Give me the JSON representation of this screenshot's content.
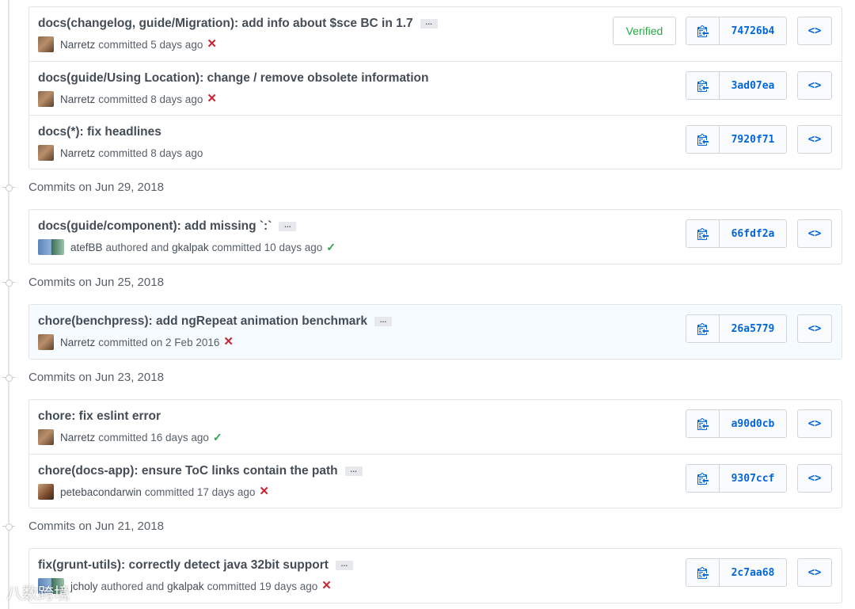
{
  "groups": [
    {
      "header": "",
      "commits": [
        {
          "title": "docs(changelog, guide/Migration): add info about $sce BC in 1.7",
          "ellipsis": true,
          "avatar": "narretz",
          "author": "Narretz",
          "meta": "committed 5 days ago",
          "status": "fail",
          "verified": "Verified",
          "sha": "74726b4",
          "highlight": false
        },
        {
          "title": "docs(guide/Using Location): change / remove obsolete information",
          "ellipsis": false,
          "avatar": "narretz",
          "author": "Narretz",
          "meta": "committed 8 days ago",
          "status": "fail",
          "verified": "",
          "sha": "3ad07ea",
          "highlight": false
        },
        {
          "title": "docs(*): fix headlines",
          "ellipsis": false,
          "avatar": "narretz",
          "author": "Narretz",
          "meta": "committed 8 days ago",
          "status": "none",
          "verified": "",
          "sha": "7920f71",
          "highlight": false
        }
      ]
    },
    {
      "header": "Commits on Jun 29, 2018",
      "commits": [
        {
          "title": "docs(guide/component): add missing `:`",
          "ellipsis": true,
          "avatar": "pair",
          "author": "atefBB",
          "meta_mid": "authored and",
          "coauthor": "gkalpak",
          "meta": "committed 10 days ago",
          "status": "pass",
          "verified": "",
          "sha": "66fdf2a",
          "highlight": false
        }
      ]
    },
    {
      "header": "Commits on Jun 25, 2018",
      "commits": [
        {
          "title": "chore(benchpress): add ngRepeat animation benchmark",
          "ellipsis": true,
          "avatar": "narretz",
          "author": "Narretz",
          "meta": "committed on 2 Feb 2016",
          "status": "fail",
          "verified": "",
          "sha": "26a5779",
          "highlight": true
        }
      ]
    },
    {
      "header": "Commits on Jun 23, 2018",
      "commits": [
        {
          "title": "chore: fix eslint error",
          "ellipsis": false,
          "avatar": "narretz",
          "author": "Narretz",
          "meta": "committed 16 days ago",
          "status": "pass",
          "verified": "",
          "sha": "a90d0cb",
          "highlight": false
        },
        {
          "title": "chore(docs-app): ensure ToC links contain the path",
          "ellipsis": true,
          "avatar": "petebacon",
          "author": "petebacondarwin",
          "meta": "committed 17 days ago",
          "status": "fail",
          "verified": "",
          "sha": "9307ccf",
          "highlight": false
        }
      ]
    },
    {
      "header": "Commits on Jun 21, 2018",
      "commits": [
        {
          "title": "fix(grunt-utils): correctly detect java 32bit support",
          "ellipsis": true,
          "avatar": "pair",
          "author": "jcholy",
          "meta_mid": "authored and",
          "coauthor": "gkalpak",
          "meta": "committed 19 days ago",
          "status": "fail",
          "verified": "",
          "sha": "2c7aa68",
          "highlight": false
        }
      ]
    }
  ],
  "labels": {
    "ellipsis": "…",
    "browse": "<>",
    "status_fail": "✕",
    "status_pass": "✓"
  },
  "icons": {
    "copy": "clipboard-icon",
    "browse": "code-icon",
    "fail": "x-icon",
    "pass": "check-icon"
  },
  "colors": {
    "link": "#0366d6",
    "fail": "#cb2431",
    "pass": "#28a745",
    "border": "#e1e4e8"
  },
  "watermark": "八数跨境"
}
